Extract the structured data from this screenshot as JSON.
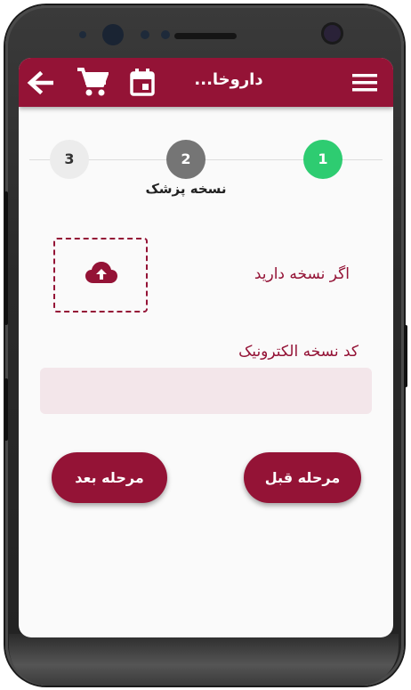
{
  "app_bar": {
    "title": "داروخا...",
    "icons": [
      "back-arrow-icon",
      "cart-icon",
      "calendar-icon",
      "menu-icon"
    ]
  },
  "stepper": {
    "steps": [
      {
        "number": "1",
        "status": "completed"
      },
      {
        "number": "2",
        "status": "active"
      },
      {
        "number": "3",
        "status": "pending"
      }
    ],
    "active_label": "نسخه پزشک"
  },
  "form": {
    "has_prescription_label": "اگر نسخه دارید",
    "upload_icon": "cloud-upload-icon",
    "electronic_code_label": "کد نسخه الکترونیک",
    "electronic_code_value": ""
  },
  "actions": {
    "next_label": "مرحله بعد",
    "prev_label": "مرحله قبل"
  },
  "colors": {
    "primary": "#941336",
    "success": "#2ecc71",
    "active_step": "#757575",
    "input_bg": "#f3e6ea"
  }
}
